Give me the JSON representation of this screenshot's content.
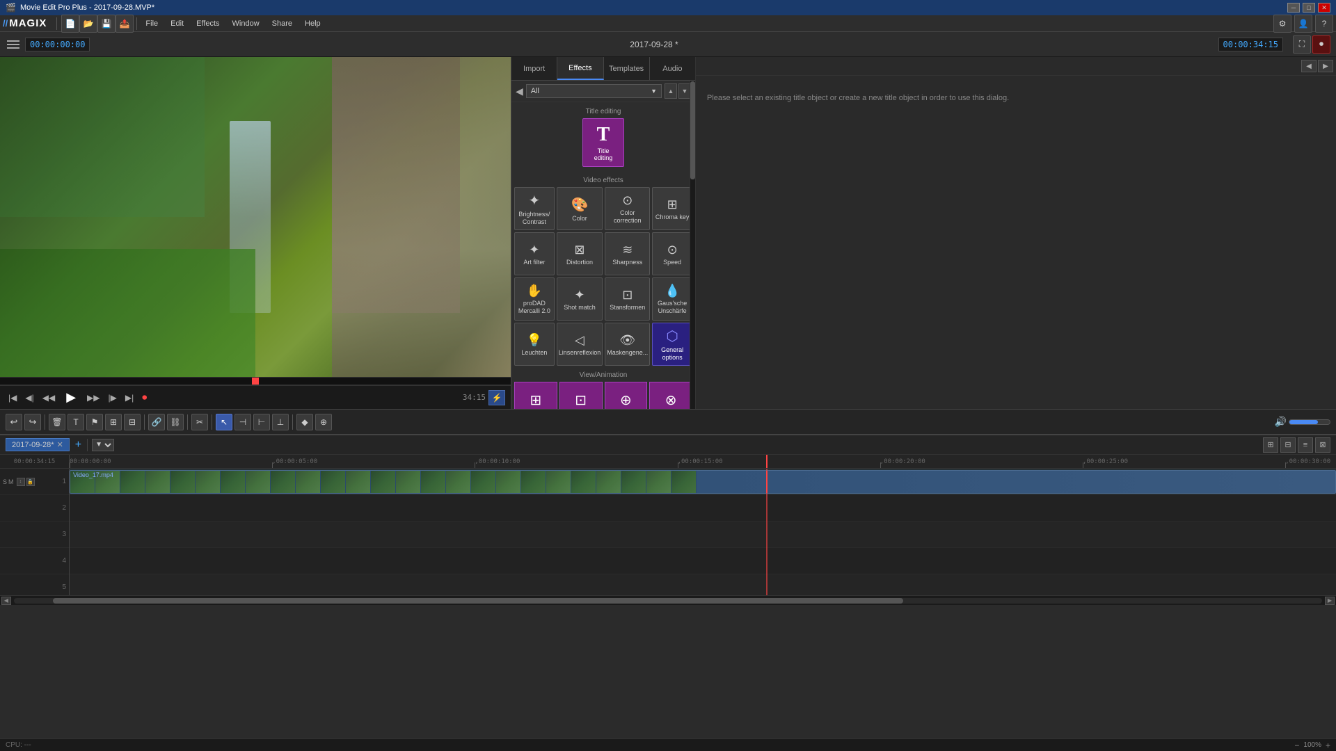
{
  "titlebar": {
    "title": "Movie Edit Pro Plus - 2017-09-28.MVP*",
    "minimize": "─",
    "maximize": "□",
    "close": "✕"
  },
  "menubar": {
    "logo": "// MAGIX",
    "menus": [
      "File",
      "Edit",
      "Effects",
      "Window",
      "Share",
      "Help"
    ],
    "icons": [
      "folder-open-icon",
      "save-icon",
      "export-icon"
    ]
  },
  "toolbar": {
    "timecode_left": "00:00:00:00",
    "timecode_center": "2017-09-28 *",
    "timecode_right": "00:00:34:15"
  },
  "effects_panel": {
    "tabs": [
      {
        "id": "import",
        "label": "Import"
      },
      {
        "id": "effects",
        "label": "Effects",
        "active": true
      },
      {
        "id": "templates",
        "label": "Templates"
      },
      {
        "id": "audio",
        "label": "Audio"
      }
    ],
    "filter_label": "All",
    "sections": [
      {
        "id": "title_editing",
        "label": "Title editing",
        "items": [
          {
            "id": "title-editing",
            "label": "Title editing",
            "icon": "T",
            "active": true
          }
        ]
      },
      {
        "id": "video_effects",
        "label": "Video effects",
        "items": [
          {
            "id": "brightness",
            "label": "Brightness/\nContrast",
            "icon": "✦"
          },
          {
            "id": "color",
            "label": "Color",
            "icon": "🎨"
          },
          {
            "id": "color-correction",
            "label": "Color correction",
            "icon": "⊙"
          },
          {
            "id": "chroma-key",
            "label": "Chroma key",
            "icon": "⊞"
          },
          {
            "id": "art-filter",
            "label": "Art filter",
            "icon": "✦"
          },
          {
            "id": "distortion",
            "label": "Distortion",
            "icon": "⊠"
          },
          {
            "id": "sharpness",
            "label": "Sharpness",
            "icon": "≋"
          },
          {
            "id": "speed",
            "label": "Speed",
            "icon": "⊙"
          },
          {
            "id": "proDad",
            "label": "proDAD Mercalli 2.0",
            "icon": "✋"
          },
          {
            "id": "shot-match",
            "label": "Shot match",
            "icon": "✦"
          },
          {
            "id": "transformations",
            "label": "Stansformen",
            "icon": "⊙"
          },
          {
            "id": "gaussian",
            "label": "Gaus'sche Unschärfe",
            "icon": "💧"
          },
          {
            "id": "leuchten",
            "label": "Leuchten",
            "icon": "💡"
          },
          {
            "id": "linsenreflexion",
            "label": "Linsenreflexion",
            "icon": "◁"
          },
          {
            "id": "maskengenee",
            "label": "Maskengene...",
            "icon": "👁"
          },
          {
            "id": "general-options",
            "label": "General options",
            "icon": "⬡",
            "active": true
          }
        ]
      },
      {
        "id": "view_animation",
        "label": "View/Animation",
        "items": [
          {
            "id": "view1",
            "label": "",
            "icon": "⊞",
            "active": true
          },
          {
            "id": "view2",
            "label": "",
            "icon": "⊡",
            "active": true
          },
          {
            "id": "view3",
            "label": "",
            "icon": "⊕",
            "active": true
          },
          {
            "id": "view4",
            "label": "",
            "icon": "⊗",
            "active": true
          }
        ]
      }
    ]
  },
  "info_panel": {
    "message": "Please select an existing title object or create a new title object in order to use this dialog."
  },
  "preview": {
    "time_display": "34:15",
    "controls": {
      "prev_frame": "◀◀",
      "prev": "◀",
      "play": "▶",
      "next": "▶",
      "next_frame": "▶▶",
      "record": "⏺"
    }
  },
  "timeline": {
    "tab_label": "2017-09-28*",
    "close_label": "✕",
    "playhead_time": "00:00:34:15",
    "clip_label": "Video_17.mp4",
    "ruler_marks": [
      "00:00:00:00",
      ",00:00:05:00",
      ",00:00:10:00",
      ",00:00:15:00",
      ",00:00:20:00",
      ",00:00:25:00",
      ",00:00:30:00"
    ],
    "tracks": [
      {
        "num": "1",
        "type": "video",
        "has_clip": true
      },
      {
        "num": "2",
        "type": "empty"
      },
      {
        "num": "3",
        "type": "empty"
      },
      {
        "num": "4",
        "type": "empty"
      },
      {
        "num": "5",
        "type": "empty"
      }
    ]
  },
  "status_bar": {
    "cpu_label": "CPU: ---",
    "zoom": "100%"
  },
  "bottom_toolbar": {
    "tools": [
      {
        "id": "undo",
        "icon": "↩",
        "label": "undo"
      },
      {
        "id": "redo",
        "icon": "↪",
        "label": "redo"
      },
      {
        "id": "delete",
        "icon": "✕",
        "label": "delete"
      },
      {
        "id": "text",
        "icon": "T",
        "label": "text"
      },
      {
        "id": "marker",
        "icon": "⚑",
        "label": "marker"
      },
      {
        "id": "group",
        "icon": "⊞",
        "label": "group"
      },
      {
        "id": "ungroup",
        "icon": "⊟",
        "label": "ungroup"
      },
      {
        "id": "link",
        "icon": "🔗",
        "label": "link"
      },
      {
        "id": "cut",
        "icon": "✂",
        "label": "cut"
      },
      {
        "id": "select",
        "icon": "↖",
        "label": "select",
        "active": true
      },
      {
        "id": "split",
        "icon": "⊣",
        "label": "split"
      },
      {
        "id": "trim",
        "icon": "⊢",
        "label": "trim"
      },
      {
        "id": "slip",
        "icon": "⊥",
        "label": "slip"
      },
      {
        "id": "razor",
        "icon": "✂",
        "label": "razor"
      },
      {
        "id": "keyframe",
        "icon": "◆",
        "label": "keyframe"
      }
    ]
  }
}
